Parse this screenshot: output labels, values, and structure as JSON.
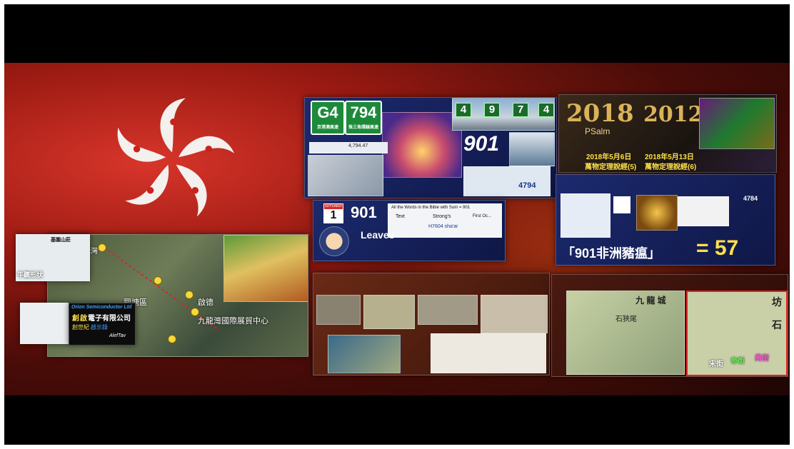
{
  "signs": {
    "g4": {
      "code": "G4",
      "name": "京港澳高速"
    },
    "g94": {
      "code": "794",
      "name": "珠三角環線高速"
    }
  },
  "collage": {
    "digits": [
      "4",
      "9",
      "7",
      "4"
    ],
    "big_number": "901",
    "code_4794": "4794",
    "dropdown_value": "4,794.47",
    "year_left": "2018",
    "year_right": "2012",
    "psalm_label": "PSalm",
    "date_left": "2018年5月6日",
    "date_right": "2018年5月13日",
    "psalm_left": "萬物定理說經(5)",
    "psalm_right": "萬物定理說經(6)",
    "calendar_day": "1",
    "calendar_month": "SEPTEMBER",
    "bible_number": "901",
    "bible_title": "All the Words in the Bible with Sum = 901",
    "col_text": "Text",
    "col_strongs": "Strong's",
    "col_first": "First Oc...",
    "strongs_code": "H7604 sha'ar",
    "leaves_label": "Leaves",
    "headline": "「901非洲豬瘟」",
    "equals_value": "= 57",
    "small_4784": "4784"
  },
  "map_panel": {
    "inset_title": "基圍山莊",
    "shape_label": "牛聽形狀",
    "label_1": "觀塘區",
    "label_2": "啟德",
    "label_3": "九龍灣國際展貿中心",
    "label_4": "牛池灣",
    "company_en": "Orion Semiconductor Ltd",
    "company_zh_1": "創",
    "company_zh_2": "啟",
    "company_zh_3": "電子有限公司",
    "sub_1": "創世紀",
    "sub_2": "啟示錄",
    "aleftav": "AlefTav"
  },
  "old_map": {
    "label_kowloon": "九 龍 城",
    "label_street": "石狹尾",
    "label_corner": "坊",
    "label_stone": "石",
    "street_1": "宋街",
    "street_2": "帝街",
    "street_3": "昺街"
  }
}
